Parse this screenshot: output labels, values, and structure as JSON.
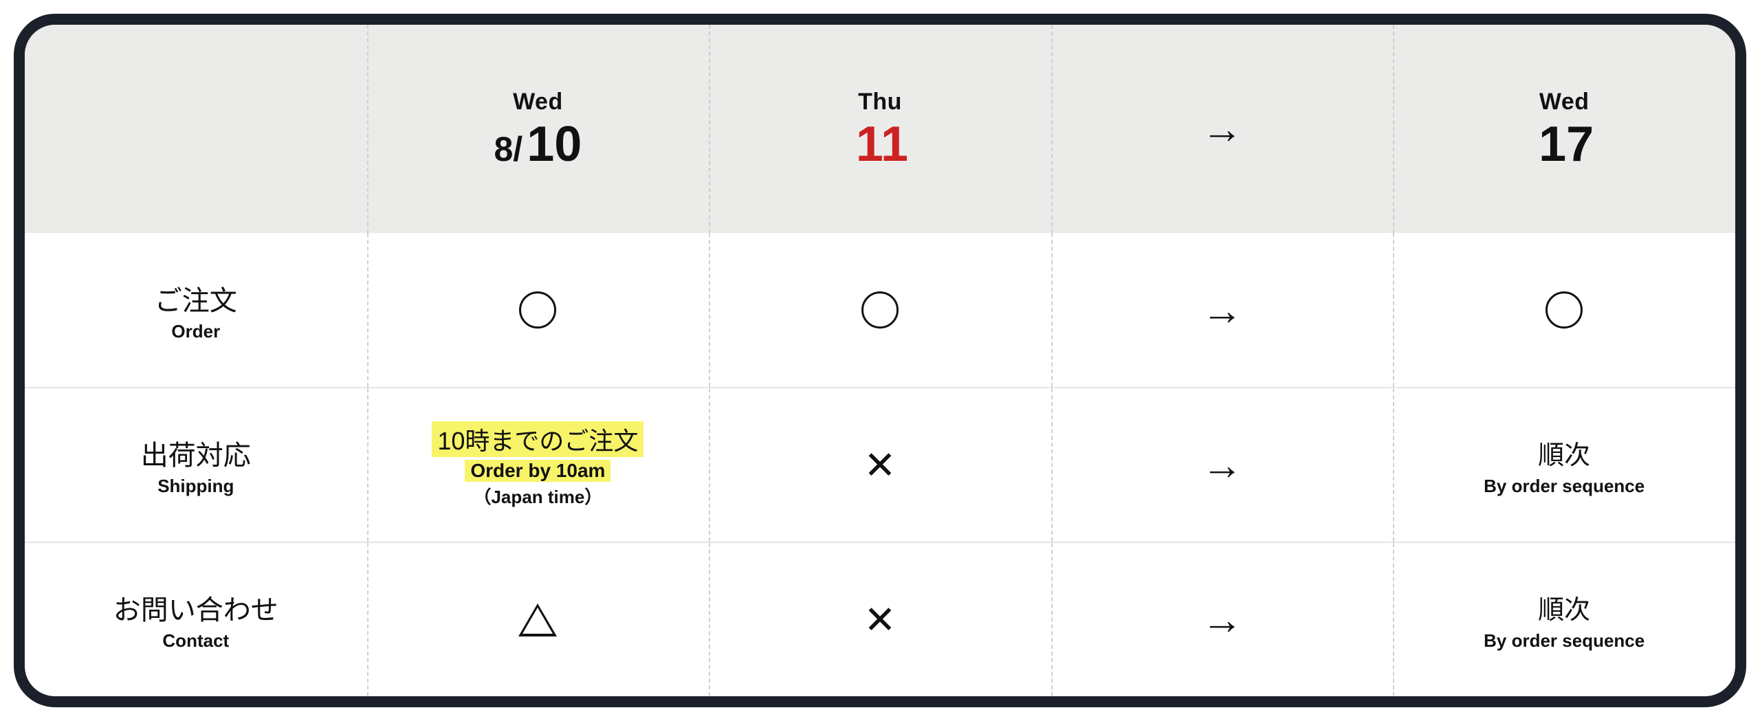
{
  "header": {
    "cells": [
      {
        "blank": true
      },
      {
        "dow": "Wed",
        "month_prefix": "8/",
        "day": "10",
        "holiday": false
      },
      {
        "dow": "Thu",
        "month_prefix": "",
        "day": "11",
        "holiday": true
      },
      {
        "arrow": "→"
      },
      {
        "dow": "Wed",
        "month_prefix": "",
        "day": "17",
        "holiday": false
      }
    ]
  },
  "rows": [
    {
      "label_jp": "ご注文",
      "label_en": "Order",
      "cells": [
        {
          "kind": "circle"
        },
        {
          "kind": "circle"
        },
        {
          "kind": "arrow",
          "text": "→"
        },
        {
          "kind": "circle"
        }
      ]
    },
    {
      "label_jp": "出荷対応",
      "label_en": "Shipping",
      "cells": [
        {
          "kind": "shipnote",
          "jp": "10時までのご注文",
          "en1": "Order by 10am",
          "en2": "（Japan time）"
        },
        {
          "kind": "x",
          "text": "✕"
        },
        {
          "kind": "arrow",
          "text": "→"
        },
        {
          "kind": "seq",
          "jp": "順次",
          "en": "By order sequence"
        }
      ]
    },
    {
      "label_jp": "お問い合わせ",
      "label_en": "Contact",
      "cells": [
        {
          "kind": "triangle"
        },
        {
          "kind": "x",
          "text": "✕"
        },
        {
          "kind": "arrow",
          "text": "→"
        },
        {
          "kind": "seq",
          "jp": "順次",
          "en": "By order sequence"
        }
      ]
    }
  ]
}
